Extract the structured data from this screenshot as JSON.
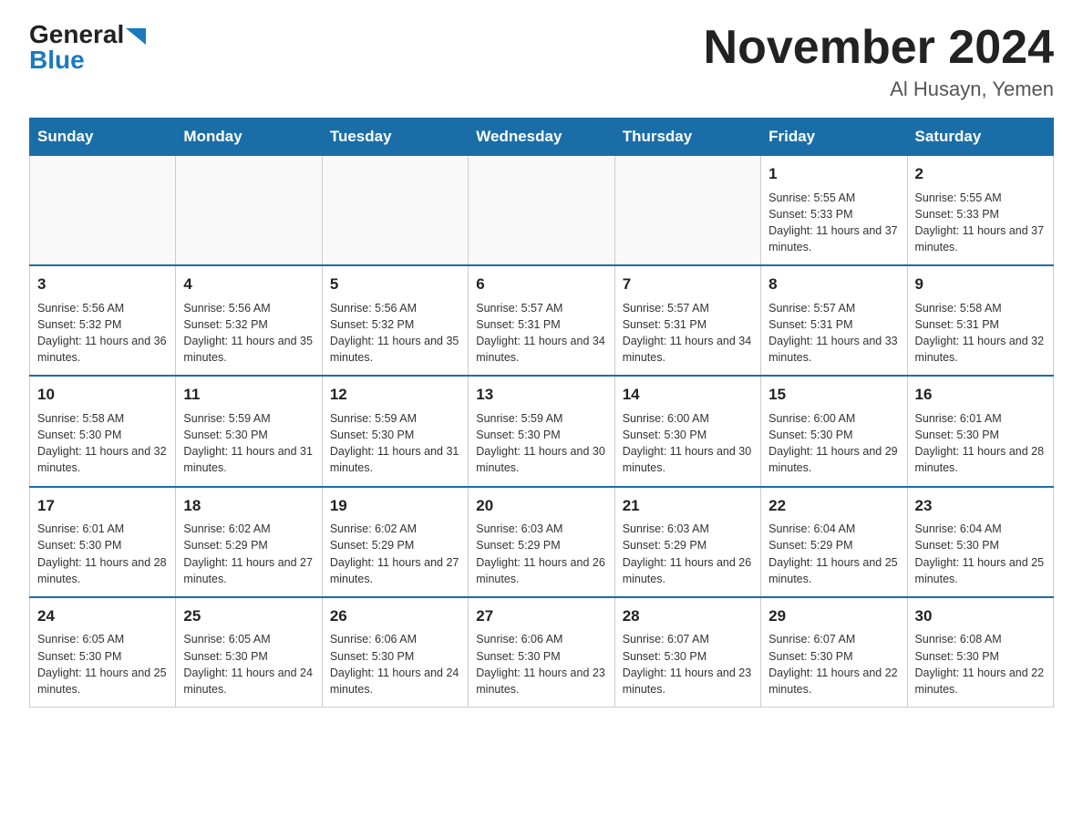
{
  "logo": {
    "general": "General",
    "blue": "Blue"
  },
  "title": {
    "month": "November 2024",
    "location": "Al Husayn, Yemen"
  },
  "weekdays": [
    "Sunday",
    "Monday",
    "Tuesday",
    "Wednesday",
    "Thursday",
    "Friday",
    "Saturday"
  ],
  "weeks": [
    [
      {
        "day": "",
        "info": ""
      },
      {
        "day": "",
        "info": ""
      },
      {
        "day": "",
        "info": ""
      },
      {
        "day": "",
        "info": ""
      },
      {
        "day": "",
        "info": ""
      },
      {
        "day": "1",
        "info": "Sunrise: 5:55 AM\nSunset: 5:33 PM\nDaylight: 11 hours and 37 minutes."
      },
      {
        "day": "2",
        "info": "Sunrise: 5:55 AM\nSunset: 5:33 PM\nDaylight: 11 hours and 37 minutes."
      }
    ],
    [
      {
        "day": "3",
        "info": "Sunrise: 5:56 AM\nSunset: 5:32 PM\nDaylight: 11 hours and 36 minutes."
      },
      {
        "day": "4",
        "info": "Sunrise: 5:56 AM\nSunset: 5:32 PM\nDaylight: 11 hours and 35 minutes."
      },
      {
        "day": "5",
        "info": "Sunrise: 5:56 AM\nSunset: 5:32 PM\nDaylight: 11 hours and 35 minutes."
      },
      {
        "day": "6",
        "info": "Sunrise: 5:57 AM\nSunset: 5:31 PM\nDaylight: 11 hours and 34 minutes."
      },
      {
        "day": "7",
        "info": "Sunrise: 5:57 AM\nSunset: 5:31 PM\nDaylight: 11 hours and 34 minutes."
      },
      {
        "day": "8",
        "info": "Sunrise: 5:57 AM\nSunset: 5:31 PM\nDaylight: 11 hours and 33 minutes."
      },
      {
        "day": "9",
        "info": "Sunrise: 5:58 AM\nSunset: 5:31 PM\nDaylight: 11 hours and 32 minutes."
      }
    ],
    [
      {
        "day": "10",
        "info": "Sunrise: 5:58 AM\nSunset: 5:30 PM\nDaylight: 11 hours and 32 minutes."
      },
      {
        "day": "11",
        "info": "Sunrise: 5:59 AM\nSunset: 5:30 PM\nDaylight: 11 hours and 31 minutes."
      },
      {
        "day": "12",
        "info": "Sunrise: 5:59 AM\nSunset: 5:30 PM\nDaylight: 11 hours and 31 minutes."
      },
      {
        "day": "13",
        "info": "Sunrise: 5:59 AM\nSunset: 5:30 PM\nDaylight: 11 hours and 30 minutes."
      },
      {
        "day": "14",
        "info": "Sunrise: 6:00 AM\nSunset: 5:30 PM\nDaylight: 11 hours and 30 minutes."
      },
      {
        "day": "15",
        "info": "Sunrise: 6:00 AM\nSunset: 5:30 PM\nDaylight: 11 hours and 29 minutes."
      },
      {
        "day": "16",
        "info": "Sunrise: 6:01 AM\nSunset: 5:30 PM\nDaylight: 11 hours and 28 minutes."
      }
    ],
    [
      {
        "day": "17",
        "info": "Sunrise: 6:01 AM\nSunset: 5:30 PM\nDaylight: 11 hours and 28 minutes."
      },
      {
        "day": "18",
        "info": "Sunrise: 6:02 AM\nSunset: 5:29 PM\nDaylight: 11 hours and 27 minutes."
      },
      {
        "day": "19",
        "info": "Sunrise: 6:02 AM\nSunset: 5:29 PM\nDaylight: 11 hours and 27 minutes."
      },
      {
        "day": "20",
        "info": "Sunrise: 6:03 AM\nSunset: 5:29 PM\nDaylight: 11 hours and 26 minutes."
      },
      {
        "day": "21",
        "info": "Sunrise: 6:03 AM\nSunset: 5:29 PM\nDaylight: 11 hours and 26 minutes."
      },
      {
        "day": "22",
        "info": "Sunrise: 6:04 AM\nSunset: 5:29 PM\nDaylight: 11 hours and 25 minutes."
      },
      {
        "day": "23",
        "info": "Sunrise: 6:04 AM\nSunset: 5:30 PM\nDaylight: 11 hours and 25 minutes."
      }
    ],
    [
      {
        "day": "24",
        "info": "Sunrise: 6:05 AM\nSunset: 5:30 PM\nDaylight: 11 hours and 25 minutes."
      },
      {
        "day": "25",
        "info": "Sunrise: 6:05 AM\nSunset: 5:30 PM\nDaylight: 11 hours and 24 minutes."
      },
      {
        "day": "26",
        "info": "Sunrise: 6:06 AM\nSunset: 5:30 PM\nDaylight: 11 hours and 24 minutes."
      },
      {
        "day": "27",
        "info": "Sunrise: 6:06 AM\nSunset: 5:30 PM\nDaylight: 11 hours and 23 minutes."
      },
      {
        "day": "28",
        "info": "Sunrise: 6:07 AM\nSunset: 5:30 PM\nDaylight: 11 hours and 23 minutes."
      },
      {
        "day": "29",
        "info": "Sunrise: 6:07 AM\nSunset: 5:30 PM\nDaylight: 11 hours and 22 minutes."
      },
      {
        "day": "30",
        "info": "Sunrise: 6:08 AM\nSunset: 5:30 PM\nDaylight: 11 hours and 22 minutes."
      }
    ]
  ]
}
